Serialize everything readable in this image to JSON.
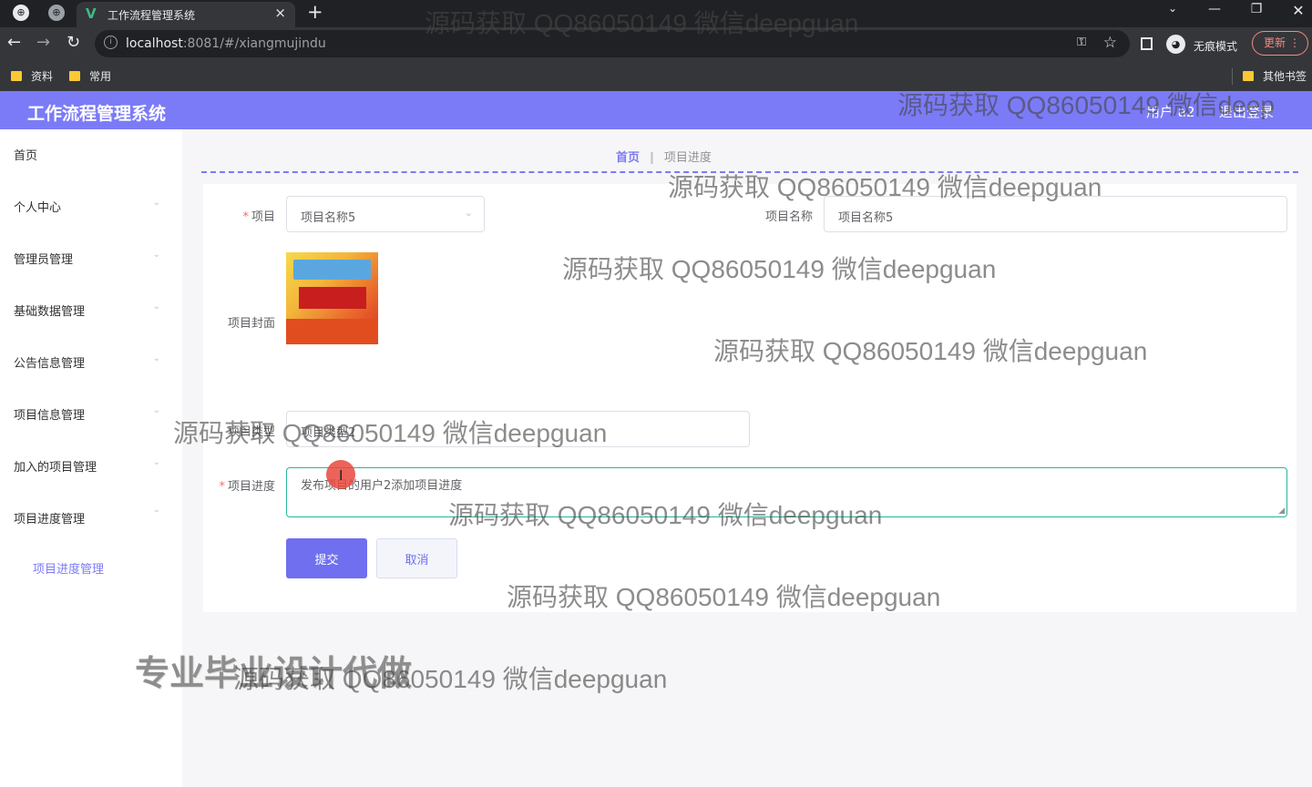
{
  "browser": {
    "tab_title": "工作流程管理系统",
    "url_host": "localhost",
    "url_path": ":8081/#/xiangmujindu",
    "incognito_label": "无痕模式",
    "update_label": "更新",
    "bookmarks": [
      "资料",
      "常用"
    ],
    "other_bookmarks": "其他书签"
  },
  "header": {
    "title": "工作流程管理系统",
    "user": "用户 a2",
    "logout": "退出登录",
    "accent_color": "#7b7bf7"
  },
  "sidebar": {
    "items": [
      {
        "label": "首页"
      },
      {
        "label": "个人中心"
      },
      {
        "label": "管理员管理"
      },
      {
        "label": "基础数据管理"
      },
      {
        "label": "公告信息管理"
      },
      {
        "label": "项目信息管理"
      },
      {
        "label": "加入的项目管理"
      },
      {
        "label": "项目进度管理"
      }
    ],
    "subitem": "项目进度管理"
  },
  "breadcrumb": {
    "home": "首页",
    "current": "项目进度"
  },
  "form": {
    "project_label": "项目",
    "project_value": "项目名称5",
    "project_name_label": "项目名称",
    "project_name_value": "项目名称5",
    "cover_label": "项目封面",
    "type_label": "项目类型",
    "type_value": "项目类型2",
    "progress_label": "项目进度",
    "progress_value": "发布项目的用户2添加项目进度",
    "submit": "提交",
    "cancel": "取消"
  },
  "watermarks": {
    "text": "源码获取 QQ86050149 微信deepguan",
    "text_cut": "源码获取 QQ86050149 微信deep",
    "big": "专业毕业设计代做"
  }
}
